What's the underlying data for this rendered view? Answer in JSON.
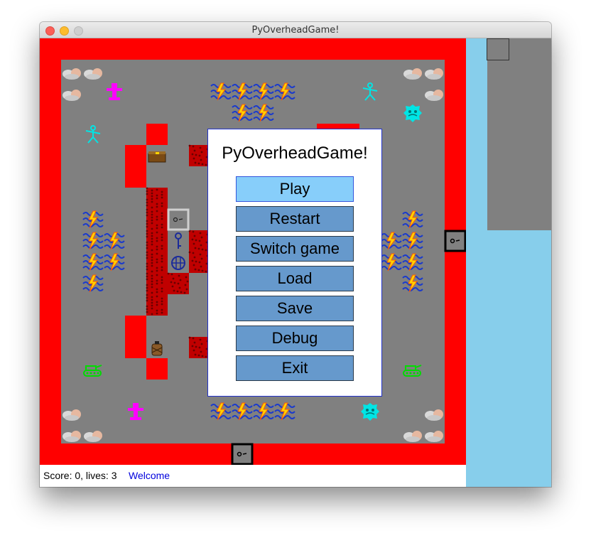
{
  "window": {
    "title": "PyOverheadGame!"
  },
  "colors": {
    "wall": "#ff0000",
    "floor": "#808080",
    "lava": "#c00000",
    "sidebar": "#87ceeb",
    "button": "#6699cc",
    "button_selected": "#87cefa",
    "status_message": "#0000dd"
  },
  "status": {
    "score_text": "Score: 0, lives: 3",
    "message": "Welcome"
  },
  "menu": {
    "title": "PyOverheadGame!",
    "items": [
      {
        "label": "Play",
        "selected": true
      },
      {
        "label": "Restart",
        "selected": false
      },
      {
        "label": "Switch game",
        "selected": false
      },
      {
        "label": "Load",
        "selected": false
      },
      {
        "label": "Save",
        "selected": false
      },
      {
        "label": "Debug",
        "selected": false
      },
      {
        "label": "Exit",
        "selected": false
      }
    ]
  },
  "board_icons": {
    "wall": "red-wall-tile",
    "lava": "lava-tile",
    "water": "water-lightning-icon",
    "rock": "rock-pile-icon",
    "door": "locked-door-icon",
    "key": "key-icon",
    "chest": "treasure-chest-icon",
    "barrel": "barrel-icon",
    "cage": "cage-icon",
    "skeleton": "skeleton-enemy-icon",
    "ghost": "ghost-enemy-icon",
    "robot": "robot-enemy-icon",
    "tank": "tank-enemy-icon"
  }
}
